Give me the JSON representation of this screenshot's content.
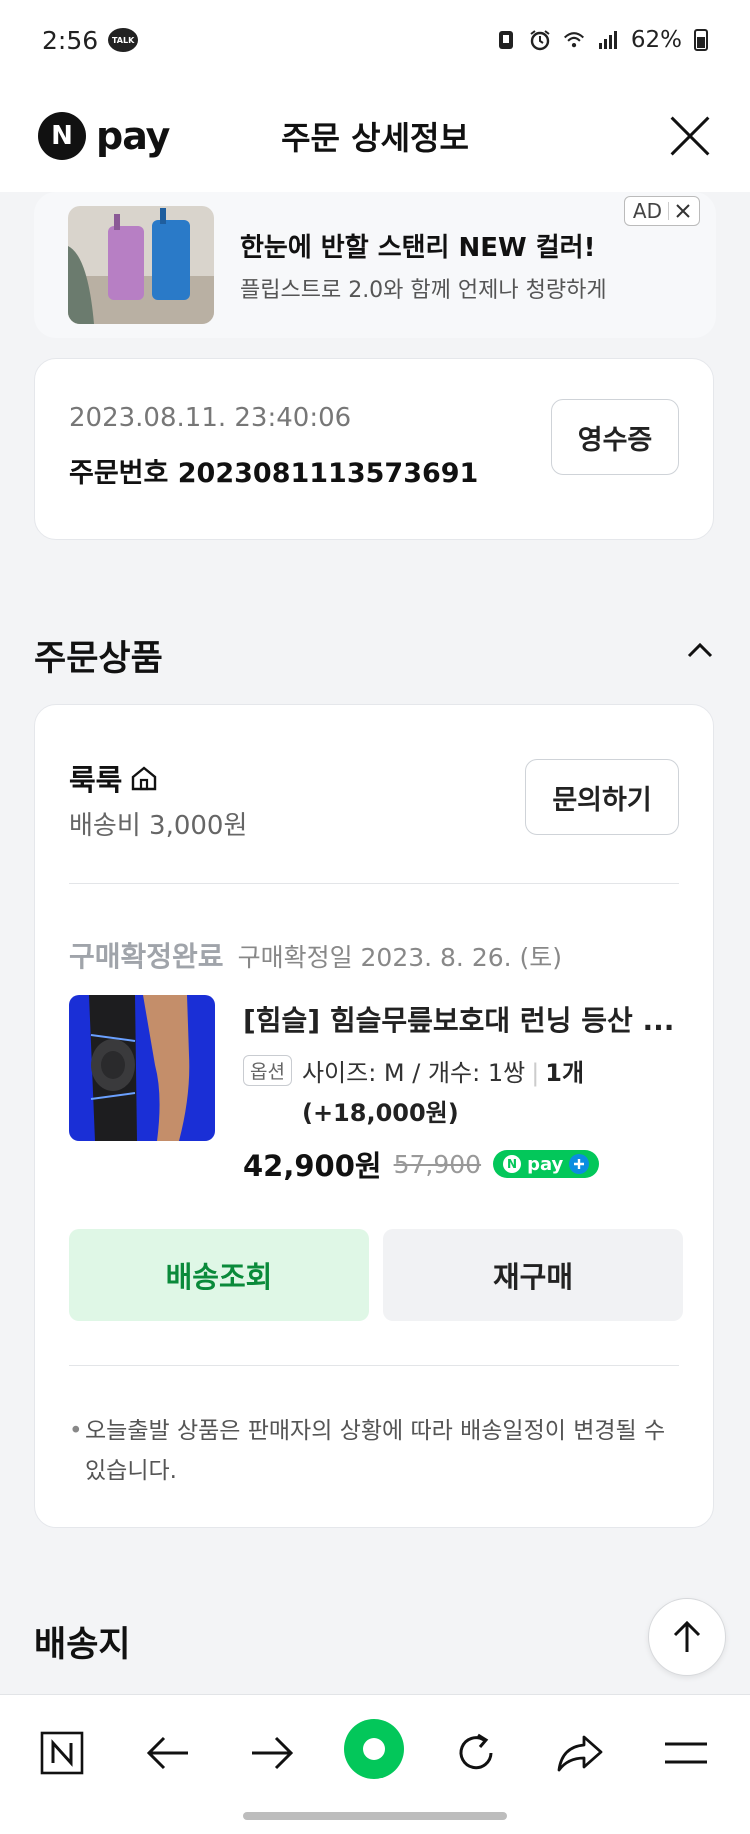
{
  "status_bar": {
    "time": "2:56",
    "talk_label": "TALK",
    "battery": "62%"
  },
  "header": {
    "logo_letter": "N",
    "logo_text": "pay",
    "title": "주문 상세정보"
  },
  "ad": {
    "title": "한눈에 반할 스탠리 NEW 컬러!",
    "subtitle": "플립스트로 2.0와 함께 언제나 청량하게",
    "badge": "AD"
  },
  "order": {
    "datetime": "2023.08.11. 23:40:06",
    "number_label": "주문번호 2023081113573691",
    "receipt_button": "영수증"
  },
  "section_products": "주문상품",
  "product_card": {
    "shop_name": "룩룩",
    "shipping_fee": "배송비 3,000원",
    "inquiry_button": "문의하기",
    "status": "구매확정완료",
    "confirm_date": "구매확정일 2023. 8. 26. (토)",
    "product_title": "[힘슬] 힘슬무릎보호대 런닝 등산 ...",
    "option_badge": "옵션",
    "option_text": "사이즈: M / 개수: 1쌍",
    "option_qty": "1개 (+18,000원)",
    "price": "42,900원",
    "original_price": "57,900",
    "npay_plus_text": "pay",
    "track_button": "배송조회",
    "rebuy_button": "재구매",
    "notice": "오늘출발 상품은 판매자의 상황에 따라 배송일정이 변경될 수 있습니다."
  },
  "section_delivery": "배송지",
  "bottom_nav": {
    "items": [
      "n-home-icon",
      "back-arrow-icon",
      "forward-arrow-icon",
      "green-dot-icon",
      "refresh-icon",
      "share-icon",
      "menu-icon"
    ],
    "n_letter": "N"
  },
  "colors": {
    "brand_green": "#03c75a",
    "track_bg": "#dff7e6",
    "track_text": "#0a8a3a"
  }
}
